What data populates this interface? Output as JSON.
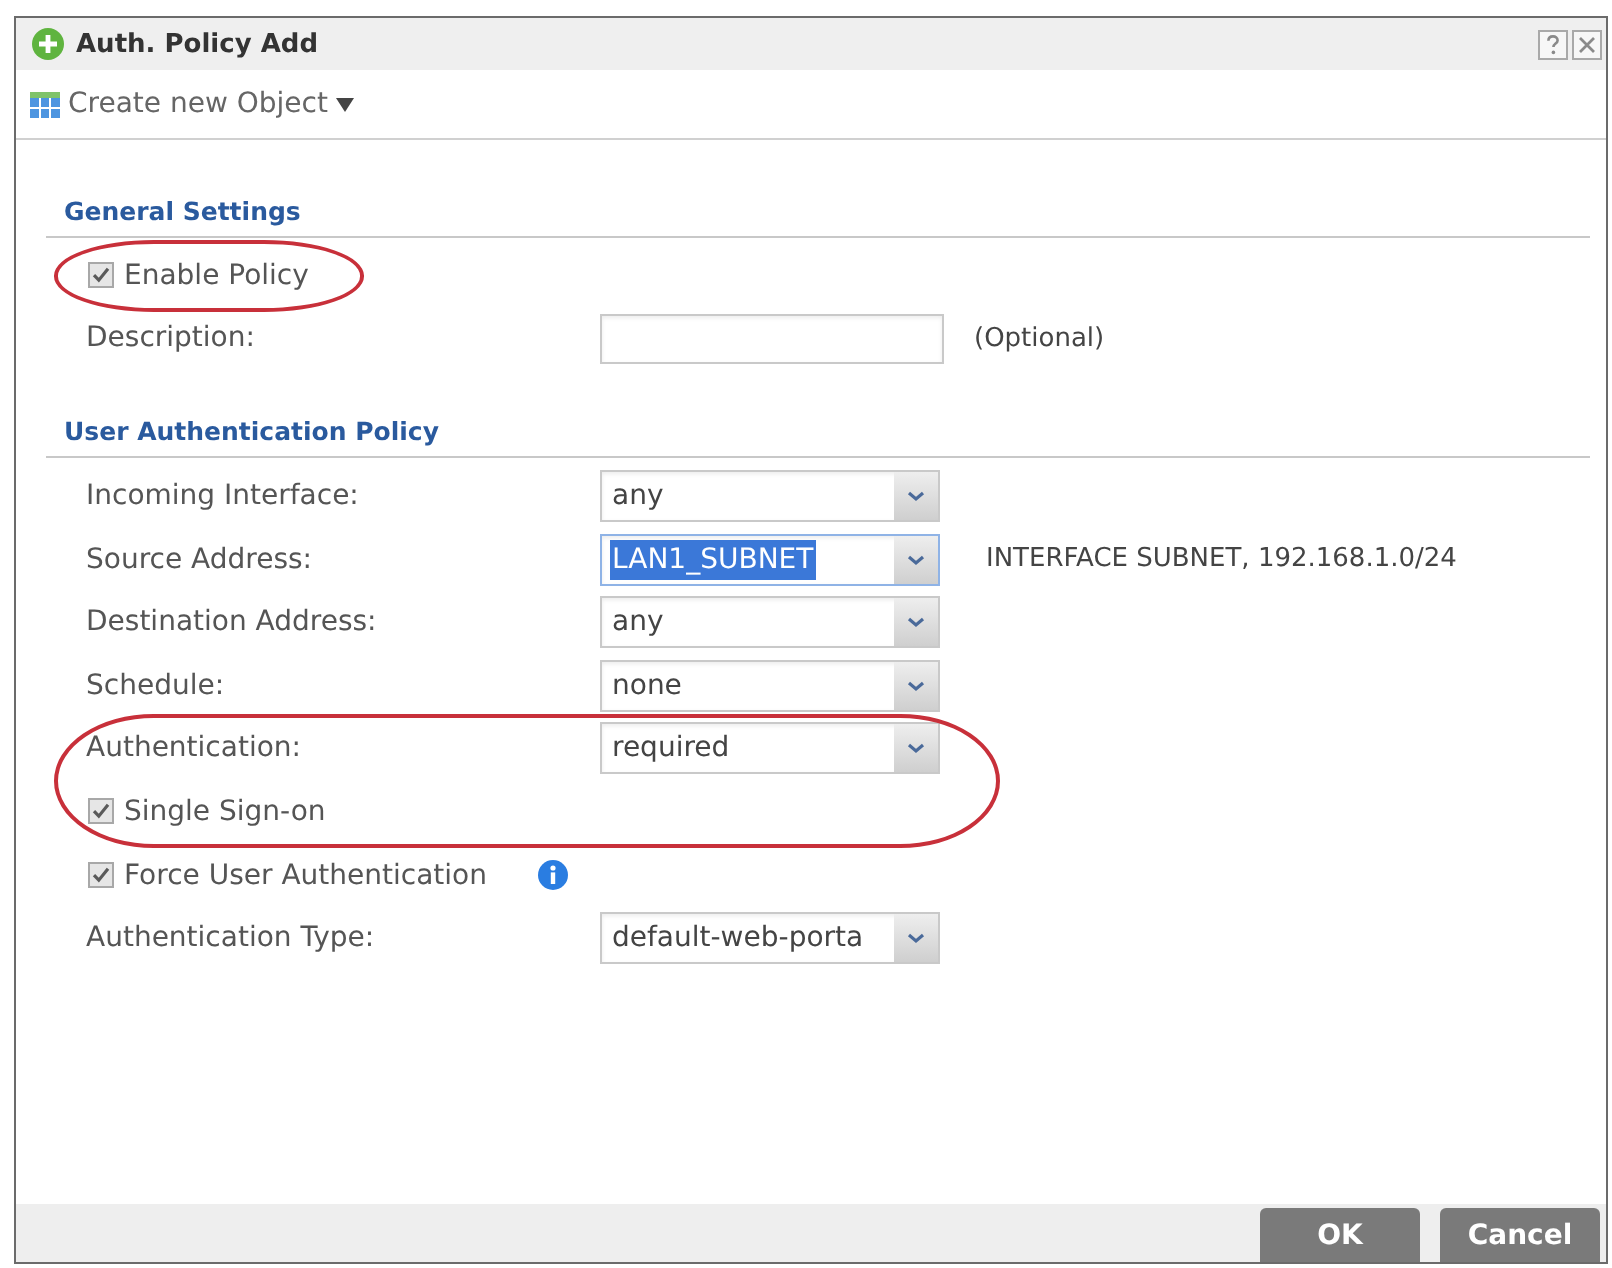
{
  "window": {
    "title": "Auth. Policy Add"
  },
  "toolbar": {
    "create_menu": "Create new Object"
  },
  "sections": [
    {
      "title": "General Settings",
      "items": [
        {
          "kind": "circled",
          "rows": [
            {
              "kind": "checkbox",
              "label": "Enable Policy",
              "checked": true,
              "info": false
            }
          ]
        },
        {
          "kind": "text",
          "label": "Description:",
          "note": "(Optional)"
        }
      ]
    },
    {
      "title": "User Authentication Policy",
      "items": [
        {
          "kind": "select",
          "label": "Incoming Interface:",
          "value": "any",
          "value_selected": false
        },
        {
          "kind": "select",
          "label": "Source Address:",
          "value": "LAN1_SUBNET",
          "value_selected": true,
          "note": "INTERFACE SUBNET, 192.168.1.0/24"
        },
        {
          "kind": "select",
          "label": "Destination Address:",
          "value": "any",
          "value_selected": false
        },
        {
          "kind": "select",
          "label": "Schedule:",
          "value": "none",
          "value_selected": false
        },
        {
          "kind": "circled",
          "rows": [
            {
              "kind": "select",
              "label": "Authentication:",
              "value": "required",
              "value_selected": false
            },
            {
              "kind": "checkbox",
              "label": "Single Sign-on",
              "checked": true,
              "info": false
            }
          ]
        },
        {
          "kind": "checkbox",
          "label": "Force User Authentication",
          "checked": true,
          "info": true
        },
        {
          "kind": "select",
          "label": "Authentication Type:",
          "value": "default-web-porta",
          "value_selected": false
        }
      ]
    }
  ],
  "buttons": [
    {
      "label": "OK"
    },
    {
      "label": "Cancel"
    }
  ]
}
